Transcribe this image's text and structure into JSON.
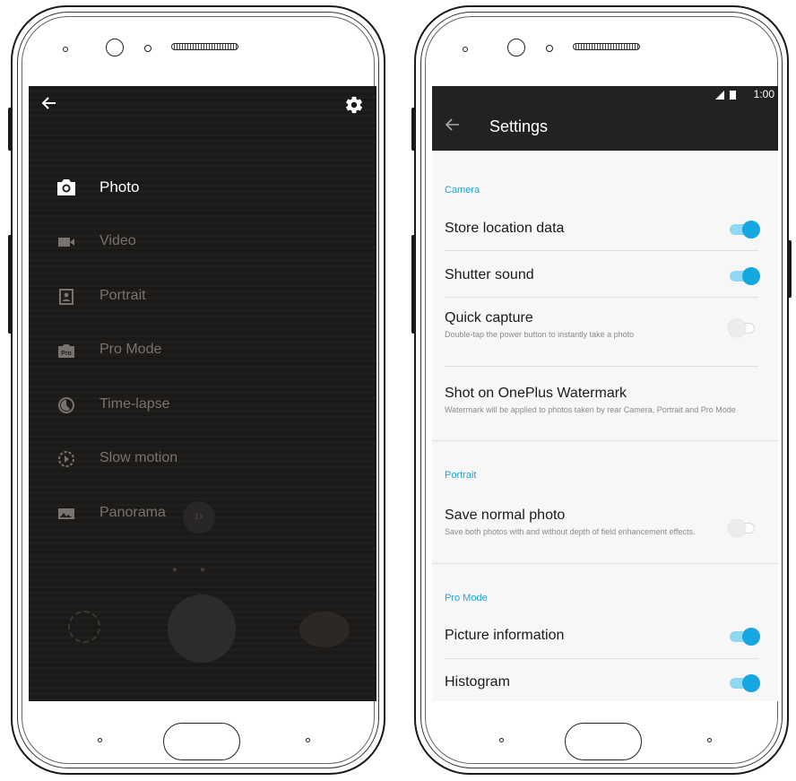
{
  "camera": {
    "back_icon": "arrow-left-icon",
    "gear_icon": "gear-icon",
    "modes": [
      {
        "label": "Photo",
        "icon": "camera-icon",
        "active": true
      },
      {
        "label": "Video",
        "icon": "video-icon",
        "active": false
      },
      {
        "label": "Portrait",
        "icon": "portrait-icon",
        "active": false
      },
      {
        "label": "Pro Mode",
        "icon": "pro-icon",
        "active": false
      },
      {
        "label": "Time-lapse",
        "icon": "timelapse-icon",
        "active": false
      },
      {
        "label": "Slow motion",
        "icon": "slow-motion-icon",
        "active": false
      },
      {
        "label": "Panorama",
        "icon": "panorama-icon",
        "active": false
      }
    ],
    "pro_badge": "Pro",
    "zoom": "1x"
  },
  "settings": {
    "status_time": "1:00",
    "title": "Settings",
    "sections": {
      "camera": "Camera",
      "portrait": "Portrait",
      "pro_mode": "Pro Mode"
    },
    "rows": {
      "store_location": {
        "title": "Store location data",
        "on": true
      },
      "shutter_sound": {
        "title": "Shutter sound",
        "on": true
      },
      "quick_capture": {
        "title": "Quick capture",
        "subtitle": "Double-tap the power button to instantly take a photo",
        "on": false
      },
      "watermark": {
        "title": "Shot on OnePlus Watermark",
        "subtitle": "Watermark will be applied to photos taken by rear Camera, Portrait and Pro Mode"
      },
      "save_normal": {
        "title": "Save normal photo",
        "subtitle": "Save both photos with and without depth of field enhancement effects.",
        "on": false
      },
      "picture_info": {
        "title": "Picture information",
        "on": true
      },
      "histogram": {
        "title": "Histogram",
        "on": true
      }
    }
  },
  "colors": {
    "accent": "#14a7e0",
    "appbar": "#222222",
    "camera_bg": "#1d1b19"
  }
}
